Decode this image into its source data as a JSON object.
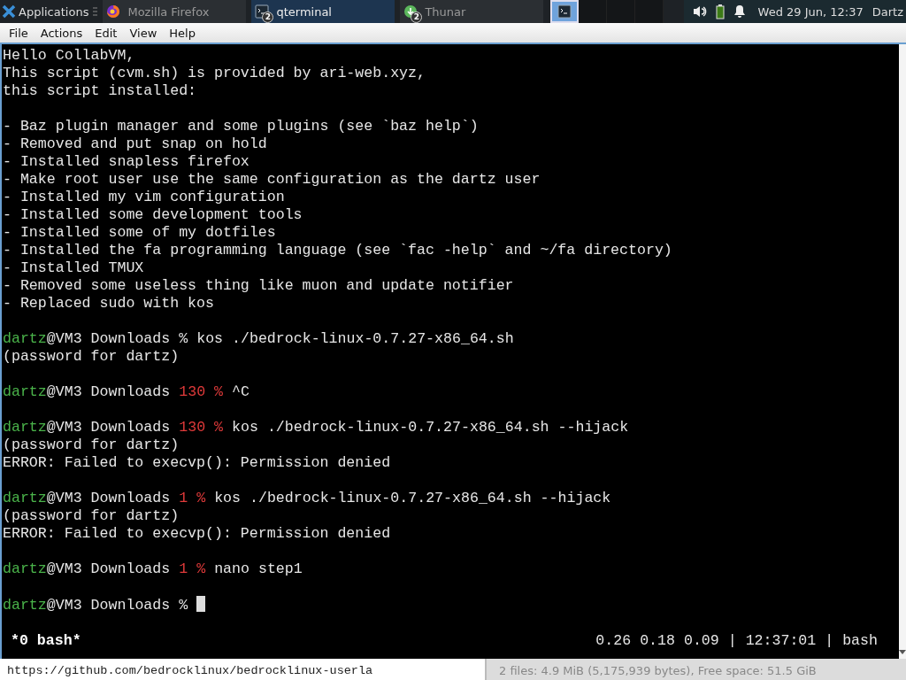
{
  "panel": {
    "app_menu": {
      "label": "Applications"
    },
    "tasks": [
      {
        "label": "Mozilla Firefox",
        "kind": "browser",
        "selected": false
      },
      {
        "label": "qterminal",
        "kind": "terminal",
        "badge": "2",
        "selected": true
      },
      {
        "label": "Thunar",
        "kind": "files",
        "badge": "2",
        "selected": false
      }
    ],
    "workspaces": [
      {
        "selected": true,
        "has_window": true
      },
      {
        "selected": false,
        "has_window": false
      },
      {
        "selected": false,
        "has_window": false
      },
      {
        "selected": false,
        "has_window": false
      }
    ],
    "clock": "Wed 29 Jun, 12:37",
    "user": "Dartz"
  },
  "menu": [
    "File",
    "Actions",
    "Edit",
    "View",
    "Help"
  ],
  "terminal": {
    "lines": [
      {
        "kind": "text",
        "text": "Hello CollabVM,"
      },
      {
        "kind": "text",
        "text": "This script (cvm.sh) is provided by ari-web.xyz,"
      },
      {
        "kind": "text",
        "text": "this script installed:"
      },
      {
        "kind": "blank"
      },
      {
        "kind": "text",
        "text": "- Baz plugin manager and some plugins (see `baz help`)"
      },
      {
        "kind": "text",
        "text": "- Removed and put snap on hold"
      },
      {
        "kind": "text",
        "text": "- Installed snapless firefox"
      },
      {
        "kind": "text",
        "text": "- Make root user use the same configuration as the dartz user"
      },
      {
        "kind": "text",
        "text": "- Installed my vim configuration"
      },
      {
        "kind": "text",
        "text": "- Installed some development tools"
      },
      {
        "kind": "text",
        "text": "- Installed some of my dotfiles"
      },
      {
        "kind": "text",
        "text": "- Installed the fa programming language (see `fac -help` and ~/fa directory)"
      },
      {
        "kind": "text",
        "text": "- Installed TMUX"
      },
      {
        "kind": "text",
        "text": "- Removed some useless thing like muon and update notifier"
      },
      {
        "kind": "text",
        "text": "- Replaced sudo with kos"
      },
      {
        "kind": "blank"
      },
      {
        "kind": "prompt",
        "user": "dartz",
        "location": "@VM3 Downloads",
        "symbol": "%",
        "command": "kos ./bedrock-linux-0.7.27-x86_64.sh",
        "cursor": false
      },
      {
        "kind": "text",
        "text": "(password for dartz)"
      },
      {
        "kind": "blank"
      },
      {
        "kind": "prompt",
        "user": "dartz",
        "location": "@VM3 Downloads",
        "exit_code": "130",
        "symbol": "%",
        "command": "^C",
        "cursor": false
      },
      {
        "kind": "blank"
      },
      {
        "kind": "prompt",
        "user": "dartz",
        "location": "@VM3 Downloads",
        "exit_code": "130",
        "symbol": "%",
        "command": "kos ./bedrock-linux-0.7.27-x86_64.sh --hijack",
        "cursor": false
      },
      {
        "kind": "text",
        "text": "(password for dartz)"
      },
      {
        "kind": "text",
        "text": "ERROR: Failed to execvp(): Permission denied"
      },
      {
        "kind": "blank"
      },
      {
        "kind": "prompt",
        "user": "dartz",
        "location": "@VM3 Downloads",
        "exit_code": "1",
        "symbol": "%",
        "command": "kos ./bedrock-linux-0.7.27-x86_64.sh --hijack",
        "cursor": false
      },
      {
        "kind": "text",
        "text": "(password for dartz)"
      },
      {
        "kind": "text",
        "text": "ERROR: Failed to execvp(): Permission denied"
      },
      {
        "kind": "blank"
      },
      {
        "kind": "prompt",
        "user": "dartz",
        "location": "@VM3 Downloads",
        "exit_code": "1",
        "symbol": "%",
        "command": "nano step1",
        "cursor": false
      },
      {
        "kind": "blank"
      },
      {
        "kind": "prompt",
        "user": "dartz",
        "location": "@VM3 Downloads",
        "symbol": "%",
        "cursor": true
      }
    ],
    "tmux_status": {
      "window": "*0 bash*",
      "right": "0.26 0.18 0.09 | 12:37:01 | bash"
    }
  },
  "background_window": {
    "text_line": "https://github.com/bedrocklinux/bedrocklinux-userla",
    "status": "2 files: 4.9 MiB (5,175,939 bytes), Free space: 51.5 GiB"
  }
}
